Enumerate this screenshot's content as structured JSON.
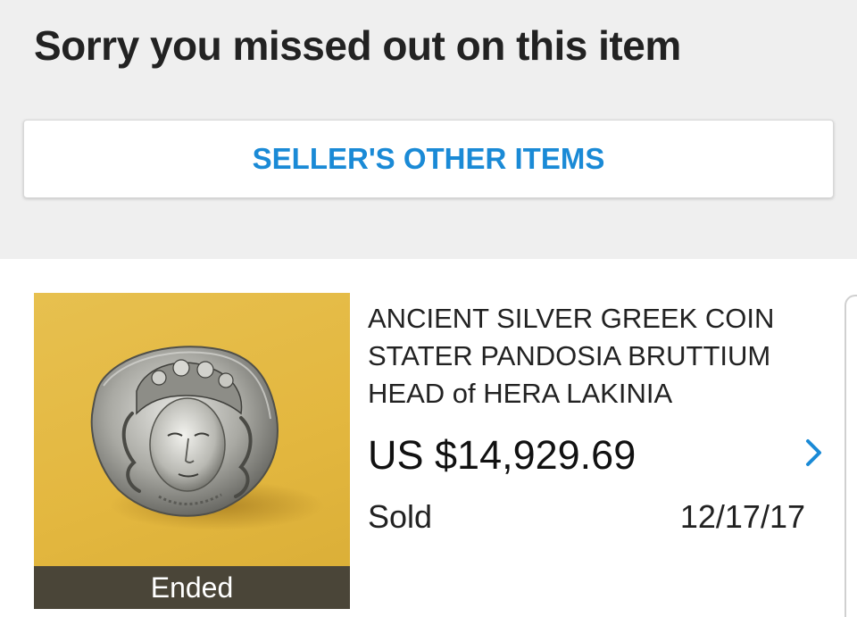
{
  "header": {
    "title": "Sorry you missed out on this item"
  },
  "actions": {
    "seller_other_items_label": "SELLER'S OTHER ITEMS"
  },
  "item": {
    "title": "ANCIENT SILVER GREEK COIN STATER PANDOSIA BRUTTIUM HEAD of HERA LAKINIA",
    "price": "US $14,929.69",
    "status": "Sold",
    "date": "12/17/17",
    "image_overlay_label": "Ended"
  },
  "colors": {
    "accent": "#1a8ad6",
    "background": "#efefef",
    "card": "#ffffff",
    "ended_bar": "#4a4538",
    "thumb_bg": "#e3b73f"
  },
  "icons": {
    "chevron": "chevron-right-icon"
  }
}
